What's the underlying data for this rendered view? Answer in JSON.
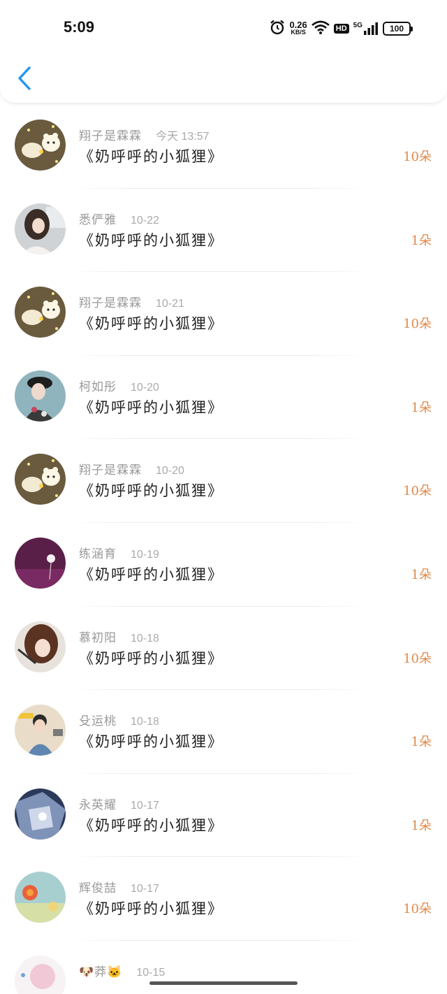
{
  "status_bar": {
    "time": "5:09",
    "net_speed_value": "0.26",
    "net_speed_unit": "KB/S",
    "hd": "HD",
    "signal_label": "5G",
    "battery": "100",
    "icons": [
      "alarm-icon",
      "wifi-icon",
      "signal-icon",
      "battery-icon"
    ]
  },
  "header": {
    "back_icon": "chevron-left-icon"
  },
  "colors": {
    "accent_count": "#e0894a",
    "back": "#2196f3"
  },
  "items": [
    {
      "name": "翔子是霖霖",
      "date": "今天 13:57",
      "gift": "《奶呼呼的小狐狸》",
      "count": "10朵",
      "avatar": "bear-avatar"
    },
    {
      "name": "悉俨雅",
      "date": "10-22",
      "gift": "《奶呼呼的小狐狸》",
      "count": "1朵",
      "avatar": "girl-avatar"
    },
    {
      "name": "翔子是霖霖",
      "date": "10-21",
      "gift": "《奶呼呼的小狐狸》",
      "count": "10朵",
      "avatar": "bear-avatar"
    },
    {
      "name": "柯如彤",
      "date": "10-20",
      "gift": "《奶呼呼的小狐狸》",
      "count": "1朵",
      "avatar": "girl-hat-avatar"
    },
    {
      "name": "翔子是霖霖",
      "date": "10-20",
      "gift": "《奶呼呼的小狐狸》",
      "count": "10朵",
      "avatar": "bear-avatar"
    },
    {
      "name": "练涵育",
      "date": "10-19",
      "gift": "《奶呼呼的小狐狸》",
      "count": "1朵",
      "avatar": "dandelion-avatar"
    },
    {
      "name": "慕初阳",
      "date": "10-18",
      "gift": "《奶呼呼的小狐狸》",
      "count": "10朵",
      "avatar": "girl-brown-avatar"
    },
    {
      "name": "殳运桃",
      "date": "10-18",
      "gift": "《奶呼呼的小狐狸》",
      "count": "1朵",
      "avatar": "boy-avatar"
    },
    {
      "name": "永英耀",
      "date": "10-17",
      "gift": "《奶呼呼的小狐狸》",
      "count": "1朵",
      "avatar": "anime-avatar"
    },
    {
      "name": "辉俊喆",
      "date": "10-17",
      "gift": "《奶呼呼的小狐狸》",
      "count": "10朵",
      "avatar": "flower-avatar"
    },
    {
      "name": "🐶莽🐱",
      "date": "10-15",
      "gift": "",
      "count": "",
      "avatar": "pink-avatar"
    }
  ]
}
